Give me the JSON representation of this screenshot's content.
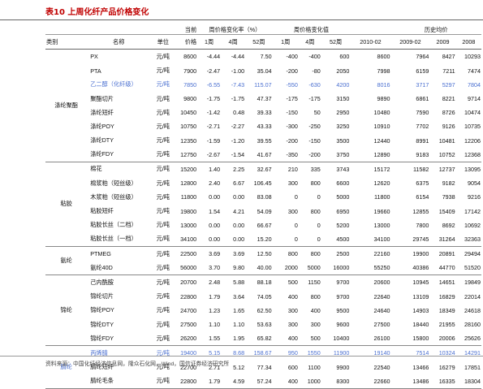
{
  "title": "表10 上周化纤产品价格变化",
  "header": {
    "category": "类别",
    "name": "名称",
    "unit": "单位",
    "current_top": "当前",
    "current": "价格",
    "pct_change": "周价格变化率（%）",
    "abs_change": "周价格变化值",
    "hist": "历史均价",
    "w1": "1周",
    "w4": "4周",
    "w52": "52周",
    "v1": "1周",
    "v4": "4周",
    "v52": "52周",
    "h1": "2010-02",
    "h2": "2009-02",
    "h3": "2009",
    "h4": "2008"
  },
  "groups": [
    {
      "category": "涤纶聚酯",
      "rows": [
        {
          "name": "PX",
          "unit": "元/吨",
          "price": "8600",
          "p1": "-4.44",
          "p4": "-4.44",
          "p52": "7.50",
          "v1": "-400",
          "v4": "-400",
          "v52": "600",
          "h1": "8600",
          "h2": "7964",
          "h3": "8427",
          "h4": "10293",
          "hl": false
        },
        {
          "name": "PTA",
          "unit": "元/吨",
          "price": "7900",
          "p1": "-2.47",
          "p4": "-1.00",
          "p52": "35.04",
          "v1": "-200",
          "v4": "-80",
          "v52": "2050",
          "h1": "7998",
          "h2": "6159",
          "h3": "7211",
          "h4": "7474",
          "hl": false
        },
        {
          "name": "乙二醇（化纤级）",
          "unit": "元/吨",
          "price": "7850",
          "p1": "-6.55",
          "p4": "-7.43",
          "p52": "115.07",
          "v1": "-550",
          "v4": "-630",
          "v52": "4200",
          "h1": "8016",
          "h2": "3717",
          "h3": "5297",
          "h4": "7804",
          "hl": true
        },
        {
          "name": "聚酯切片",
          "unit": "元/吨",
          "price": "9800",
          "p1": "-1.75",
          "p4": "-1.75",
          "p52": "47.37",
          "v1": "-175",
          "v4": "-175",
          "v52": "3150",
          "h1": "9890",
          "h2": "6861",
          "h3": "8221",
          "h4": "9714",
          "hl": false
        },
        {
          "name": "涤纶短纤",
          "unit": "元/吨",
          "price": "10450",
          "p1": "-1.42",
          "p4": "0.48",
          "p52": "39.33",
          "v1": "-150",
          "v4": "50",
          "v52": "2950",
          "h1": "10480",
          "h2": "7590",
          "h3": "8726",
          "h4": "10474",
          "hl": false
        },
        {
          "name": "涤纶POY",
          "unit": "元/吨",
          "price": "10750",
          "p1": "-2.71",
          "p4": "-2.27",
          "p52": "43.33",
          "v1": "-300",
          "v4": "-250",
          "v52": "3250",
          "h1": "10910",
          "h2": "7702",
          "h3": "9126",
          "h4": "10735",
          "hl": false
        },
        {
          "name": "涤纶DTY",
          "unit": "元/吨",
          "price": "12350",
          "p1": "-1.59",
          "p4": "-1.20",
          "p52": "39.55",
          "v1": "-200",
          "v4": "-150",
          "v52": "3500",
          "h1": "12440",
          "h2": "8991",
          "h3": "10481",
          "h4": "12206",
          "hl": false
        },
        {
          "name": "涤纶FDY",
          "unit": "元/吨",
          "price": "12750",
          "p1": "-2.67",
          "p4": "-1.54",
          "p52": "41.67",
          "v1": "-350",
          "v4": "-200",
          "v52": "3750",
          "h1": "12890",
          "h2": "9183",
          "h3": "10752",
          "h4": "12368",
          "hl": false
        }
      ]
    },
    {
      "category": "粘胶",
      "rows": [
        {
          "name": "棉花",
          "unit": "元/吨",
          "price": "15200",
          "p1": "1.40",
          "p4": "2.25",
          "p52": "32.67",
          "v1": "210",
          "v4": "335",
          "v52": "3743",
          "h1": "15172",
          "h2": "11582",
          "h3": "12737",
          "h4": "13095",
          "hl": false
        },
        {
          "name": "棉浆粕（短丝级）",
          "unit": "元/吨",
          "price": "12800",
          "p1": "2.40",
          "p4": "6.67",
          "p52": "106.45",
          "v1": "300",
          "v4": "800",
          "v52": "6600",
          "h1": "12620",
          "h2": "6375",
          "h3": "9182",
          "h4": "9054",
          "hl": false
        },
        {
          "name": "木浆粕（短丝级）",
          "unit": "元/吨",
          "price": "11800",
          "p1": "0.00",
          "p4": "0.00",
          "p52": "83.08",
          "v1": "0",
          "v4": "0",
          "v52": "5000",
          "h1": "11800",
          "h2": "6154",
          "h3": "7938",
          "h4": "9216",
          "hl": false
        },
        {
          "name": "粘胶短纤",
          "unit": "元/吨",
          "price": "19800",
          "p1": "1.54",
          "p4": "4.21",
          "p52": "54.09",
          "v1": "300",
          "v4": "800",
          "v52": "6950",
          "h1": "19660",
          "h2": "12855",
          "h3": "15409",
          "h4": "17142",
          "hl": false
        },
        {
          "name": "粘胶长丝（二档）",
          "unit": "元/吨",
          "price": "13000",
          "p1": "0.00",
          "p4": "0.00",
          "p52": "66.67",
          "v1": "0",
          "v4": "0",
          "v52": "5200",
          "h1": "13000",
          "h2": "7800",
          "h3": "8692",
          "h4": "10692",
          "hl": false
        },
        {
          "name": "粘胶长丝（一档）",
          "unit": "元/吨",
          "price": "34100",
          "p1": "0.00",
          "p4": "0.00",
          "p52": "15.20",
          "v1": "0",
          "v4": "0",
          "v52": "4500",
          "h1": "34100",
          "h2": "29745",
          "h3": "31264",
          "h4": "32363",
          "hl": false
        }
      ]
    },
    {
      "category": "氨纶",
      "rows": [
        {
          "name": "PTMEG",
          "unit": "元/吨",
          "price": "22500",
          "p1": "3.69",
          "p4": "3.69",
          "p52": "12.50",
          "v1": "800",
          "v4": "800",
          "v52": "2500",
          "h1": "22160",
          "h2": "19900",
          "h3": "20891",
          "h4": "29494",
          "hl": false
        },
        {
          "name": "氨纶40D",
          "unit": "元/吨",
          "price": "56000",
          "p1": "3.70",
          "p4": "9.80",
          "p52": "40.00",
          "v1": "2000",
          "v4": "5000",
          "v52": "16000",
          "h1": "55250",
          "h2": "40386",
          "h3": "44770",
          "h4": "51520",
          "hl": false
        }
      ]
    },
    {
      "category": "锦纶",
      "rows": [
        {
          "name": "己内酰胺",
          "unit": "元/吨",
          "price": "20700",
          "p1": "2.48",
          "p4": "5.88",
          "p52": "88.18",
          "v1": "500",
          "v4": "1150",
          "v52": "9700",
          "h1": "20600",
          "h2": "10945",
          "h3": "14651",
          "h4": "19849",
          "hl": false
        },
        {
          "name": "锦纶切片",
          "unit": "元/吨",
          "price": "22800",
          "p1": "1.79",
          "p4": "3.64",
          "p52": "74.05",
          "v1": "400",
          "v4": "800",
          "v52": "9700",
          "h1": "22640",
          "h2": "13109",
          "h3": "16829",
          "h4": "22014",
          "hl": false
        },
        {
          "name": "锦纶POY",
          "unit": "元/吨",
          "price": "24700",
          "p1": "1.23",
          "p4": "1.65",
          "p52": "62.50",
          "v1": "300",
          "v4": "400",
          "v52": "9500",
          "h1": "24640",
          "h2": "14903",
          "h3": "18349",
          "h4": "24618",
          "hl": false
        },
        {
          "name": "锦纶DTY",
          "unit": "元/吨",
          "price": "27500",
          "p1": "1.10",
          "p4": "1.10",
          "p52": "53.63",
          "v1": "300",
          "v4": "300",
          "v52": "9600",
          "h1": "27500",
          "h2": "18440",
          "h3": "21955",
          "h4": "28160",
          "hl": false
        },
        {
          "name": "锦纶FDY",
          "unit": "元/吨",
          "price": "26200",
          "p1": "1.55",
          "p4": "1.95",
          "p52": "65.82",
          "v1": "400",
          "v4": "500",
          "v52": "10400",
          "h1": "26100",
          "h2": "15800",
          "h3": "20006",
          "h4": "25626",
          "hl": false
        }
      ]
    },
    {
      "category": "腈纶",
      "rows": [
        {
          "name": "丙烯腈",
          "unit": "元/吨",
          "price": "19400",
          "p1": "5.15",
          "p4": "8.68",
          "p52": "158.67",
          "v1": "950",
          "v4": "1550",
          "v52": "11900",
          "h1": "19140",
          "h2": "7514",
          "h3": "10324",
          "h4": "14291",
          "hl": true
        },
        {
          "name": "腈纶短纤",
          "unit": "元/吨",
          "price": "22700",
          "p1": "2.71",
          "p4": "5.12",
          "p52": "77.34",
          "v1": "600",
          "v4": "1100",
          "v52": "9900",
          "h1": "22540",
          "h2": "13466",
          "h3": "16279",
          "h4": "17851",
          "hl": false
        },
        {
          "name": "腈纶毛条",
          "unit": "元/吨",
          "price": "22800",
          "p1": "1.79",
          "p4": "4.59",
          "p52": "57.24",
          "v1": "400",
          "v4": "1000",
          "v52": "8300",
          "h1": "22660",
          "h2": "13486",
          "h3": "16335",
          "h4": "18304",
          "hl": false
        }
      ]
    }
  ],
  "source": "资料来源：中国化纤经济信息网，隆众石化网，Wind，国信证券经济研究所"
}
